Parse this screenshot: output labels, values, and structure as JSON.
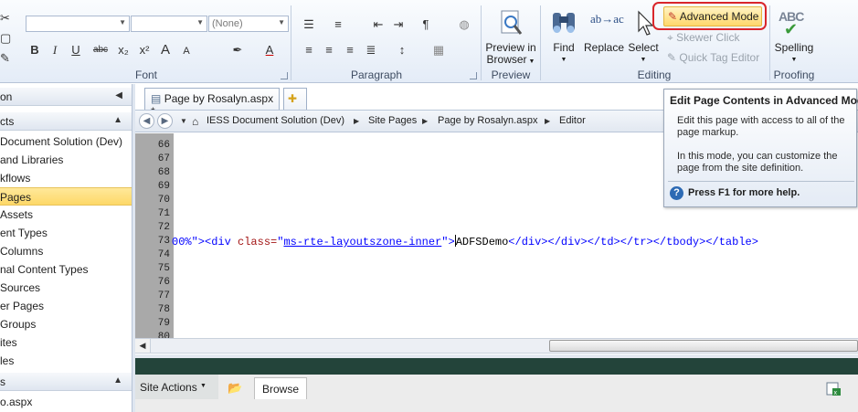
{
  "ribbon": {
    "font": {
      "style_combo": "(None)",
      "group_label": "Font",
      "buttons": [
        "B",
        "I",
        "U",
        "abc",
        "x₂",
        "x²",
        "A",
        "A"
      ]
    },
    "paragraph": {
      "group_label": "Paragraph",
      "pilcrow": "¶"
    },
    "preview": {
      "button_label_1": "Preview in",
      "button_label_2": "Browser",
      "group_label": "Preview"
    },
    "editing": {
      "find_label": "Find",
      "replace_label": "Replace",
      "replace_icon_text": "ab→ac",
      "select_label": "Select",
      "advanced_mode_label": "Advanced Mode",
      "skewer_click_label": "Skewer Click",
      "quick_tag_editor_label": "Quick Tag Editor",
      "group_label": "Editing"
    },
    "proofing": {
      "spelling_label": "Spelling",
      "spelling_icon_text": "ABC",
      "group_label": "Proofing"
    }
  },
  "left_nav": {
    "header_top": "on",
    "header_objects": "cts",
    "items": [
      {
        "label": "Document Solution (Dev)",
        "selected": false
      },
      {
        "label": "and Libraries",
        "selected": false
      },
      {
        "label": "kflows",
        "selected": false
      },
      {
        "label": "Pages",
        "selected": true
      },
      {
        "label": "Assets",
        "selected": false
      },
      {
        "label": "ent Types",
        "selected": false
      },
      {
        "label": "Columns",
        "selected": false
      },
      {
        "label": "nal Content Types",
        "selected": false
      },
      {
        "label": "Sources",
        "selected": false
      },
      {
        "label": "er Pages",
        "selected": false
      },
      {
        "label": "Groups",
        "selected": false
      },
      {
        "label": "ites",
        "selected": false
      },
      {
        "label": "les",
        "selected": false
      }
    ],
    "header_files": "s",
    "file_item": "o.aspx"
  },
  "tabs": [
    {
      "label": "Page by Rosalyn.aspx *"
    }
  ],
  "breadcrumb": [
    "IESS Document Solution (Dev)",
    "Site Pages",
    "Page by Rosalyn.aspx",
    "Editor"
  ],
  "editor": {
    "line_numbers": [
      "66",
      "67",
      "68",
      "69",
      "70",
      "71",
      "72",
      "73",
      "74",
      "75",
      "76",
      "77",
      "78",
      "79",
      "80"
    ],
    "code_line_73": {
      "prefix": "00%\">",
      "tag_open": "<div ",
      "attr": "class=",
      "quote_open": "\"",
      "value": "ms-rte-layoutszone-inner",
      "quote_close": "\"",
      "gt": ">",
      "text": "ADFSDemo",
      "tail": "</div></div></td></tr></tbody></table>"
    }
  },
  "preview_strip": {
    "site_actions": "Site Actions",
    "browse_tab": "Browse"
  },
  "tooltip": {
    "title": "Edit Page Contents in Advanced Mode",
    "body_1": "Edit this page with access to all of the page markup.",
    "body_2": "In this mode, you can customize the page from the site definition.",
    "help": "Press F1 for more help."
  },
  "colors": {
    "accent_selected": "#fdd868",
    "highlight_ring": "#d9262b",
    "preview_band": "#23443a"
  }
}
